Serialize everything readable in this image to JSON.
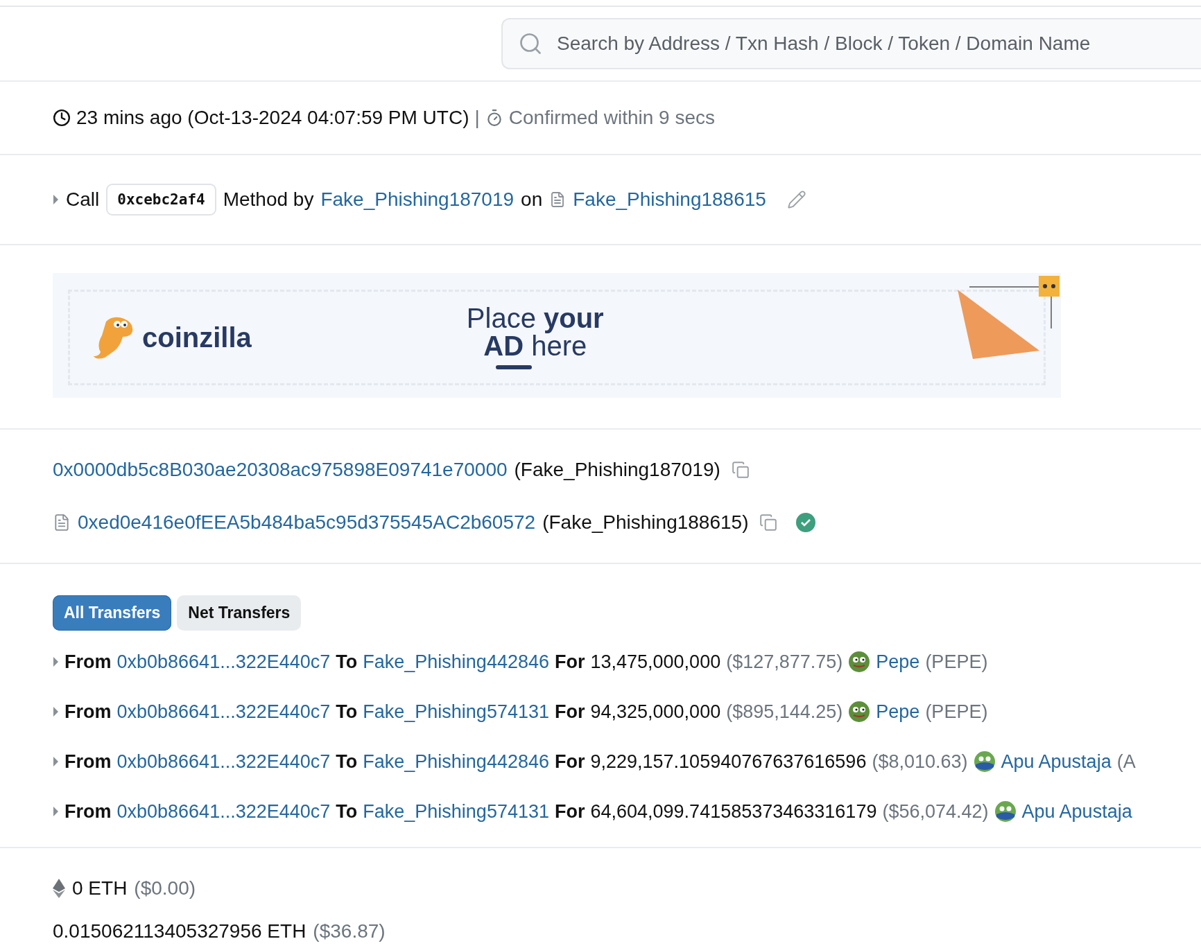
{
  "search": {
    "placeholder": "Search by Address / Txn Hash / Block / Token / Domain Name"
  },
  "timestamp": {
    "age": "23 mins ago (Oct-13-2024 04:07:59 PM UTC)",
    "separator": "|",
    "confirmation": "Confirmed within 9 secs"
  },
  "call": {
    "label": "Call",
    "method_id": "0xcebc2af4",
    "method_text": "Method by",
    "caller": "Fake_Phishing187019",
    "on_text": "on",
    "contract": "Fake_Phishing188615"
  },
  "ad": {
    "brand": "coinzilla",
    "line1": "Place **your**",
    "line2": "**AD** here"
  },
  "addresses": [
    {
      "kind": "account",
      "address": "0x0000db5c8B030ae20308ac975898E09741e70000",
      "name": "(Fake_Phishing187019)",
      "verified": false
    },
    {
      "kind": "contract",
      "address": "0xed0e416e0fEEA5b484ba5c95d375545AC2b60572",
      "name": "(Fake_Phishing188615)",
      "verified": true
    }
  ],
  "tabs": [
    {
      "label": "All Transfers",
      "selected": true
    },
    {
      "label": "Net Transfers",
      "selected": false
    }
  ],
  "transfers": [
    {
      "from_label": "From",
      "from": "0xb0b86641...322E440c7",
      "to_label": "To",
      "to": "Fake_Phishing442846",
      "for_label": "For",
      "amount": "13,475,000,000",
      "usd": "($127,877.75)",
      "kind": "pepe",
      "token": "Pepe",
      "symbol": "(PEPE)"
    },
    {
      "from_label": "From",
      "from": "0xb0b86641...322E440c7",
      "to_label": "To",
      "to": "Fake_Phishing574131",
      "for_label": "For",
      "amount": "94,325,000,000",
      "usd": "($895,144.25)",
      "kind": "pepe",
      "token": "Pepe",
      "symbol": "(PEPE)"
    },
    {
      "from_label": "From",
      "from": "0xb0b86641...322E440c7",
      "to_label": "To",
      "to": "Fake_Phishing442846",
      "for_label": "For",
      "amount": "9,229,157.105940767637616596",
      "usd": "($8,010.63)",
      "kind": "apu",
      "token": "Apu Apustaja",
      "symbol": "(A"
    },
    {
      "from_label": "From",
      "from": "0xb0b86641...322E440c7",
      "to_label": "To",
      "to": "Fake_Phishing574131",
      "for_label": "For",
      "amount": "64,604,099.741585373463316179",
      "usd": "($56,074.42)",
      "kind": "apu",
      "token": "Apu Apustaja"
    }
  ],
  "values": [
    {
      "kind": "eth",
      "amount": "0 ETH",
      "usd": "($0.00)"
    },
    {
      "kind": "plain",
      "amount": "0.015062113405327956 ETH",
      "usd": "($36.87)"
    }
  ]
}
